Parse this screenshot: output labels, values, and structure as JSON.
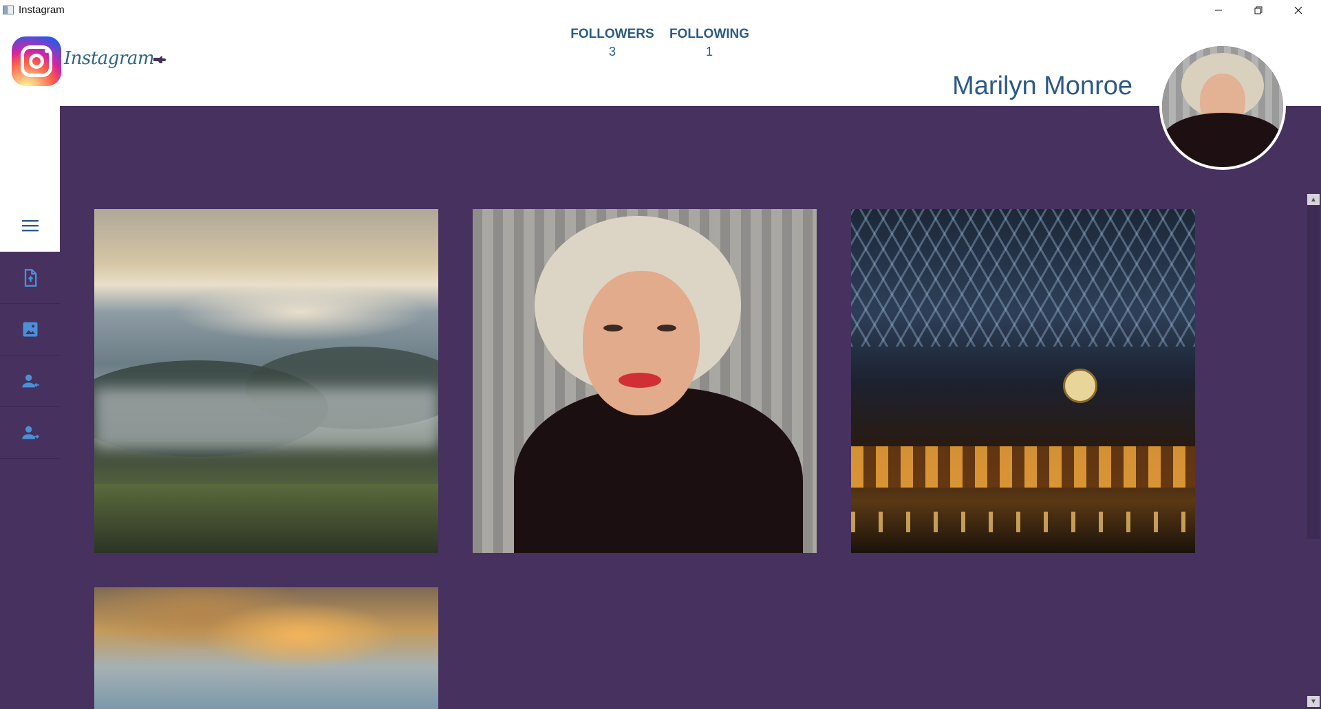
{
  "window": {
    "title": "Instagram",
    "controls": [
      "minimize",
      "restore",
      "close"
    ]
  },
  "header": {
    "brand": "Instagram",
    "followers_label": "FOLLOWERS",
    "followers_count": "3",
    "following_label": "FOLLOWING",
    "following_count": "1",
    "username": "Marilyn Monroe"
  },
  "sidebar": {
    "items": [
      {
        "icon": "menu-icon"
      },
      {
        "icon": "upload-file-icon"
      },
      {
        "icon": "gallery-icon"
      },
      {
        "icon": "followers-icon"
      },
      {
        "icon": "following-icon"
      }
    ]
  },
  "gallery": {
    "photos": [
      {
        "subject": "misty-hills"
      },
      {
        "subject": "portrait"
      },
      {
        "subject": "train-station"
      },
      {
        "subject": "sunset-clouds"
      }
    ]
  },
  "colors": {
    "accent": "#2c5a86",
    "panel": "#46315f",
    "sidebar_icon": "#4a90d9"
  }
}
